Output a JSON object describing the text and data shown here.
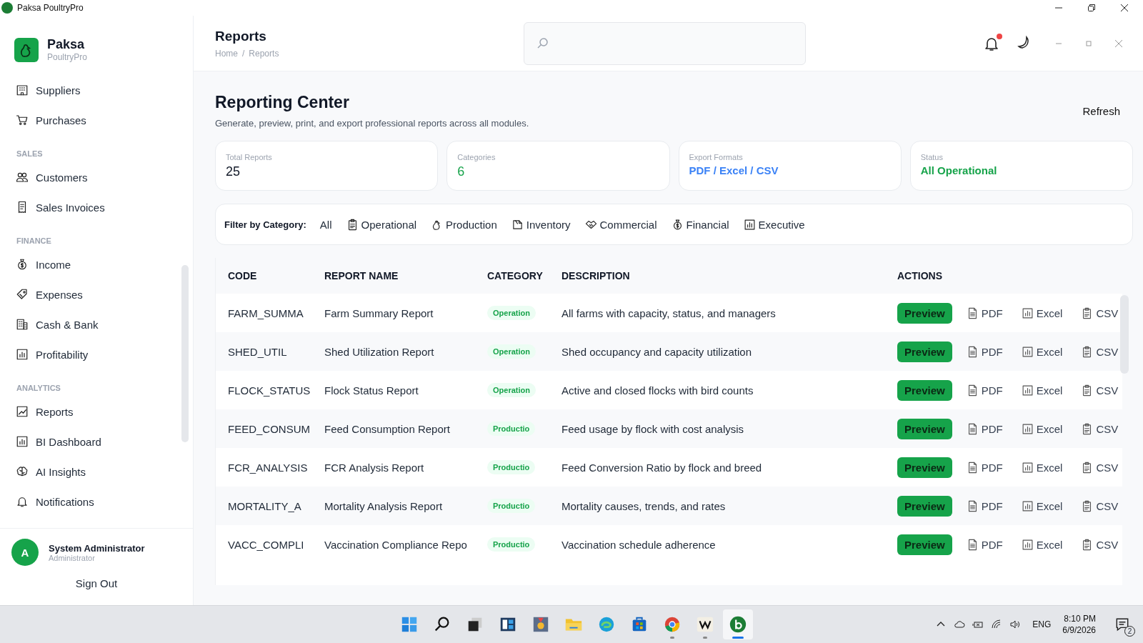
{
  "title_bar": {
    "title": "Paksa PoultryPro"
  },
  "sidebar": {
    "brand": {
      "name": "Paksa",
      "subtitle": "PoultryPro"
    },
    "sections": [
      {
        "items": [
          {
            "label": "Suppliers",
            "kind": "building"
          },
          {
            "label": "Purchases",
            "kind": "cart"
          }
        ]
      },
      {
        "heading": "SALES",
        "items": [
          {
            "label": "Customers",
            "kind": "people"
          },
          {
            "label": "Sales Invoices",
            "kind": "receipt"
          }
        ]
      },
      {
        "heading": "FINANCE",
        "items": [
          {
            "label": "Income",
            "kind": "moneybag"
          },
          {
            "label": "Expenses",
            "kind": "tag"
          },
          {
            "label": "Cash & Bank",
            "kind": "bank"
          },
          {
            "label": "Profitability",
            "kind": "chart"
          }
        ]
      },
      {
        "heading": "ANALYTICS",
        "items": [
          {
            "label": "Reports",
            "kind": "trend"
          },
          {
            "label": "BI Dashboard",
            "kind": "chart"
          },
          {
            "label": "AI Insights",
            "kind": "brain"
          },
          {
            "label": "Notifications",
            "kind": "bell"
          }
        ]
      }
    ],
    "user": {
      "initial": "A",
      "name": "System Administrator",
      "role": "Administrator"
    },
    "sign_out": "Sign Out"
  },
  "header": {
    "title": "Reports",
    "breadcrumb": [
      "Home",
      "Reports"
    ],
    "breadcrumb_separator": "/",
    "notifications_unread": true
  },
  "page": {
    "title": "Reporting Center",
    "subtitle": "Generate, preview, print, and export professional reports across all modules.",
    "refresh": "Refresh"
  },
  "stats": [
    {
      "label": "Total Reports",
      "value": "25",
      "color": "#111827"
    },
    {
      "label": "Categories",
      "value": "6",
      "color": "#16a34a"
    },
    {
      "label": "Export Formats",
      "value": "PDF / Excel / CSV",
      "color": "#3b82f6"
    },
    {
      "label": "Status",
      "value": "All Operational",
      "color": "#16a34a"
    }
  ],
  "filter": {
    "label": "Filter by Category:",
    "options": [
      {
        "label": "All"
      },
      {
        "label": "Operational",
        "kind": "clipboard"
      },
      {
        "label": "Production",
        "kind": "hen"
      },
      {
        "label": "Inventory",
        "kind": "box"
      },
      {
        "label": "Commercial",
        "kind": "handshake"
      },
      {
        "label": "Financial",
        "kind": "moneybag"
      },
      {
        "label": "Executive",
        "kind": "chart"
      }
    ]
  },
  "table": {
    "columns": [
      "CODE",
      "REPORT NAME",
      "CATEGORY",
      "DESCRIPTION",
      "ACTIONS"
    ],
    "rows": [
      {
        "code": "FARM_SUMMA",
        "name": "Farm Summary Report",
        "category": "Operation",
        "description": "All farms with capacity, status, and managers",
        "actions": [
          "Preview",
          "PDF",
          "Excel",
          "CSV"
        ]
      },
      {
        "code": "SHED_UTIL",
        "name": "Shed Utilization Report",
        "category": "Operation",
        "description": "Shed occupancy and capacity utilization",
        "actions": [
          "Preview",
          "PDF",
          "Excel",
          "CSV"
        ]
      },
      {
        "code": "FLOCK_STATUS",
        "name": "Flock Status Report",
        "category": "Operation",
        "description": "Active and closed flocks with bird counts",
        "actions": [
          "Preview",
          "PDF",
          "Excel",
          "CSV"
        ]
      },
      {
        "code": "FEED_CONSUM",
        "name": "Feed Consumption Report",
        "category": "Productio",
        "description": "Feed usage by flock with cost analysis",
        "actions": [
          "Preview",
          "PDF",
          "Excel",
          "CSV"
        ]
      },
      {
        "code": "FCR_ANALYSIS",
        "name": "FCR Analysis Report",
        "category": "Productio",
        "description": "Feed Conversion Ratio by flock and breed",
        "actions": [
          "Preview",
          "PDF",
          "Excel",
          "CSV"
        ]
      },
      {
        "code": "MORTALITY_A",
        "name": "Mortality Analysis Report",
        "category": "Productio",
        "description": "Mortality causes, trends, and rates",
        "actions": [
          "Preview",
          "PDF",
          "Excel",
          "CSV"
        ]
      },
      {
        "code": "VACC_COMPLI",
        "name": "Vaccination Compliance Repo",
        "category": "Productio",
        "description": "Vaccination schedule adherence",
        "actions": [
          "Preview",
          "PDF",
          "Excel",
          "CSV"
        ]
      }
    ]
  },
  "taskbar": {
    "apps": [
      {
        "kind": "start",
        "running": false,
        "selected": false
      },
      {
        "kind": "search",
        "running": false,
        "selected": false
      },
      {
        "kind": "taskview",
        "running": false,
        "selected": false
      },
      {
        "kind": "widgets",
        "running": false,
        "selected": false
      },
      {
        "kind": "medal",
        "running": false,
        "selected": false
      },
      {
        "kind": "folder",
        "running": false,
        "selected": false
      },
      {
        "kind": "edge",
        "running": false,
        "selected": false
      },
      {
        "kind": "store",
        "running": false,
        "selected": false
      },
      {
        "kind": "chrome",
        "running": true,
        "selected": false
      },
      {
        "kind": "wapp",
        "running": true,
        "selected": false
      },
      {
        "kind": "paksa",
        "running": true,
        "selected": true
      }
    ],
    "language": "ENG",
    "time": "8:10 PM",
    "date": "6/9/2026",
    "notification_count": "2"
  }
}
